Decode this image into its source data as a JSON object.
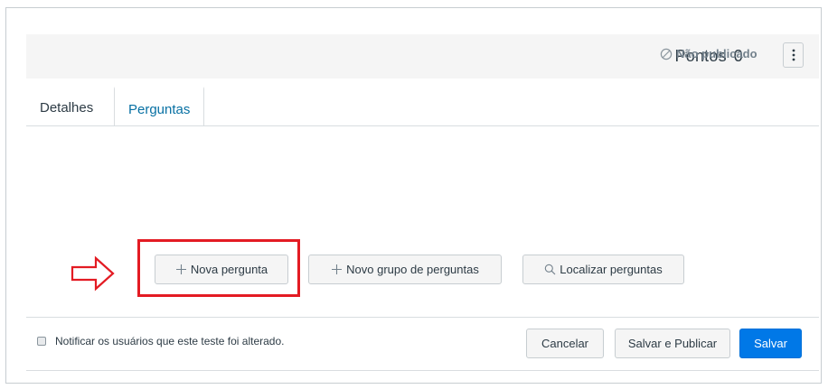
{
  "header": {
    "points_label": "Pontos",
    "points_value": "0",
    "status": "Não publicado",
    "menu_icon": "kebab-vertical-icon"
  },
  "tabs": [
    {
      "label": "Detalhes",
      "active": false
    },
    {
      "label": "Perguntas",
      "active": true
    }
  ],
  "actions": {
    "new_question": "Nova pergunta",
    "new_group": "Novo grupo de perguntas",
    "find_questions": "Localizar perguntas"
  },
  "footer": {
    "notify_label": "Notificar os usuários que este teste foi alterado.",
    "notify_checked": false,
    "cancel": "Cancelar",
    "save_publish": "Salvar e Publicar",
    "save": "Salvar"
  },
  "colors": {
    "accent": "#0078e7",
    "tab_active": "#0770a3",
    "highlight": "#e31b23",
    "header_bg": "#f5f5f5"
  }
}
